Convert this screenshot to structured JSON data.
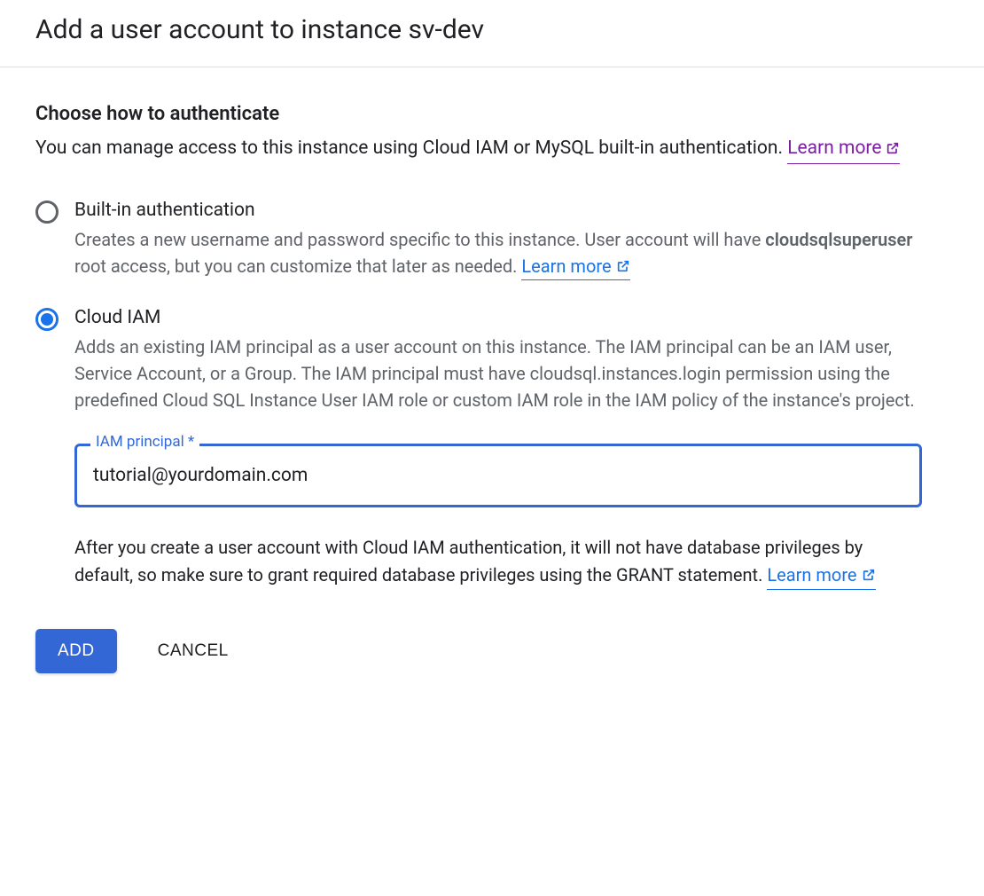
{
  "header": {
    "title": "Add a user account to instance sv-dev"
  },
  "auth_section": {
    "title": "Choose how to authenticate",
    "description": "You can manage access to this instance using Cloud IAM or MySQL built-in authentication. ",
    "learn_more": "Learn more"
  },
  "options": {
    "builtin": {
      "label": "Built-in authentication",
      "desc_pre": "Creates a new username and password specific to this instance. User account will have ",
      "desc_strong": "cloudsqlsuperuser",
      "desc_post": " root access, but you can customize that later as needed. ",
      "learn_more": "Learn more"
    },
    "cloudiam": {
      "label": "Cloud IAM",
      "description": "Adds an existing IAM principal as a user account on this instance. The IAM principal can be an IAM user, Service Account, or a Group. The IAM principal must have cloudsql.instances.login permission using the predefined Cloud SQL Instance User IAM role or custom IAM role in the IAM policy of the instance's project."
    }
  },
  "input": {
    "label": "IAM principal *",
    "value": "tutorial@yourdomain.com"
  },
  "helper": {
    "text": "After you create a user account with Cloud IAM authentication, it will not have database privileges by default, so make sure to grant required database privileges using the GRANT statement. ",
    "learn_more": "Learn more"
  },
  "buttons": {
    "add": "ADD",
    "cancel": "CANCEL"
  }
}
